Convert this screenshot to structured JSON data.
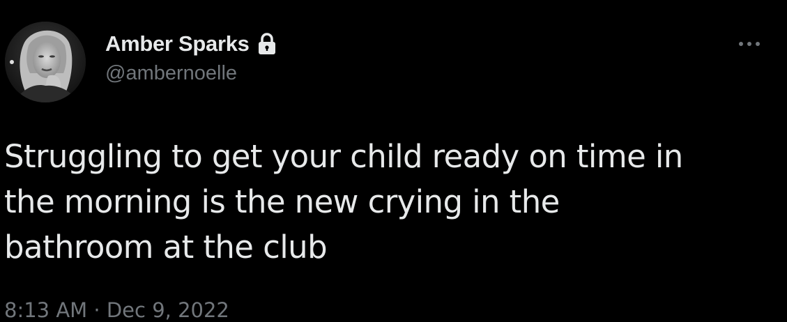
{
  "tweet": {
    "author": {
      "display_name": "Amber Sparks",
      "handle": "@ambernoelle",
      "avatar_icon": "profile-photo",
      "protected_icon": "lock-icon"
    },
    "more_icon": "more-horizontal-icon",
    "text": "Struggling to get your child ready on time in\nthe morning is the new crying in the\nbathroom at the club",
    "timestamp": "8:13 AM · Dec 9, 2022"
  },
  "colors": {
    "background": "#000000",
    "primary_text": "#e7e9ea",
    "secondary_text": "#71767b"
  }
}
